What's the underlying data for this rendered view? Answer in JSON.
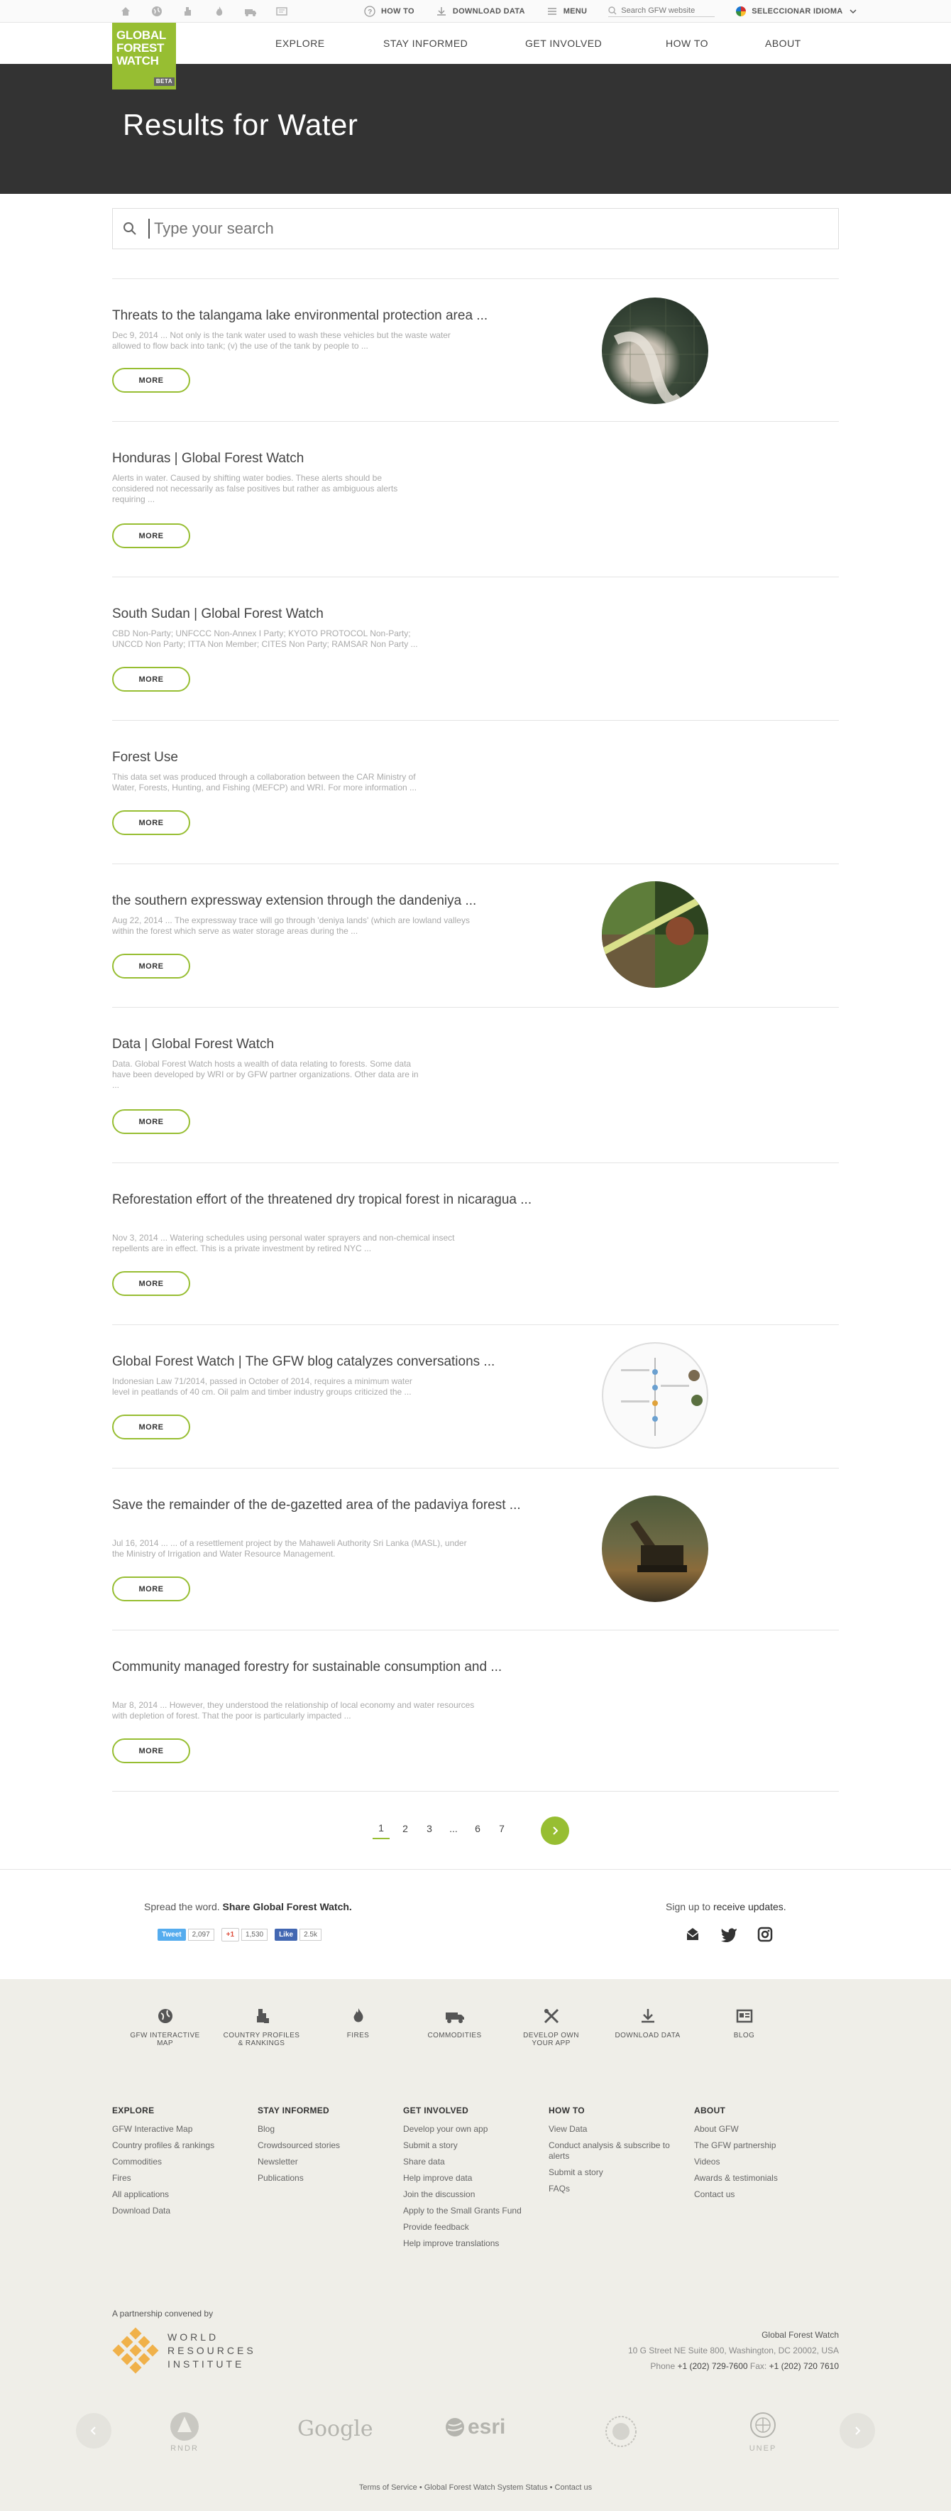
{
  "util": {
    "how_to": "HOW TO",
    "download_data": "DOWNLOAD DATA",
    "menu": "MENU",
    "search_placeholder": "Search GFW website",
    "language": "SELECCIONAR IDIOMA"
  },
  "logo": {
    "line1": "GLOBAL",
    "line2": "FOREST",
    "line3": "WATCH",
    "beta": "BETA"
  },
  "nav": [
    "EXPLORE",
    "STAY INFORMED",
    "GET INVOLVED",
    "HOW TO",
    "ABOUT"
  ],
  "banner": {
    "title": "Results for Water"
  },
  "search": {
    "placeholder": "Type your search"
  },
  "more_label": "MORE",
  "results": [
    {
      "title": "Threats to the talangama lake environmental protection area ...",
      "snippet_1": "Dec 9, 2014 ... Not only is the tank water used to wash these vehicles but the waste water",
      "snippet_2": "allowed to flow back into tank; (v) the use of the tank by people to ...",
      "snippet_3": ""
    },
    {
      "title": "Honduras | Global Forest Watch",
      "snippet_1": "Alerts in water. Caused by shifting water bodies. These alerts should be",
      "snippet_2": "considered not necessarily as false positives but rather as ambiguous alerts",
      "snippet_3": "requiring ..."
    },
    {
      "title": "South Sudan | Global Forest Watch",
      "snippet_1": "CBD Non-Party; UNFCCC Non-Annex I Party; KYOTO PROTOCOL Non-Party;",
      "snippet_2": "UNCCD Non Party; ITTA Non Member; CITES Non Party; RAMSAR Non Party ...",
      "snippet_3": ""
    },
    {
      "title": "Forest Use",
      "snippet_1": "This data set was produced through a collaboration between the CAR Ministry of",
      "snippet_2": "Water, Forests, Hunting, and Fishing (MEFCP) and WRI. For more information ...",
      "snippet_3": ""
    },
    {
      "title": "the southern expressway extension through the dandeniya ...",
      "snippet_1": "Aug 22, 2014 ... The expressway trace will go through 'deniya lands' (which are lowland valleys",
      "snippet_2": "within the forest which serve as water storage areas during the ...",
      "snippet_3": ""
    },
    {
      "title": "Data | Global Forest Watch",
      "snippet_1": "Data. Global Forest Watch hosts a wealth of data relating to forests. Some data",
      "snippet_2": "have been developed by WRI or by GFW partner organizations. Other data are in",
      "snippet_3": "..."
    },
    {
      "title": "Reforestation effort of the threatened dry tropical forest in nicaragua ...",
      "snippet_1": "Nov 3, 2014 ... Watering schedules using personal water sprayers and non-chemical insect",
      "snippet_2": "repellents are in effect. This is a private investment by retired NYC ...",
      "snippet_3": ""
    },
    {
      "title": "Global Forest Watch | The GFW blog catalyzes conversations ...",
      "snippet_1": "Indonesian Law 71/2014, passed in October of 2014, requires a minimum water",
      "snippet_2": "level in peatlands of 40 cm. Oil palm and timber industry groups criticized the ...",
      "snippet_3": ""
    },
    {
      "title": "Save the remainder of the de-gazetted area of the padaviya forest ...",
      "snippet_1": "Jul 16, 2014 ... ... of a resettlement project by the Mahaweli Authority Sri Lanka (MASL), under",
      "snippet_2": "the Ministry of Irrigation and Water Resource Management.",
      "snippet_3": ""
    },
    {
      "title": "Community managed forestry for sustainable consumption and ...",
      "snippet_1": "Mar 8, 2014 ... However, they understood the relationship of local economy and water resources",
      "snippet_2": "with depletion of forest. That the poor is particularly impacted ...",
      "snippet_3": ""
    }
  ],
  "pagination": {
    "pages": [
      "1",
      "2",
      "3",
      "...",
      "6",
      "7"
    ],
    "current": "1"
  },
  "share": {
    "spread": "Spread the word.",
    "share_cta": "Share Global Forest Watch.",
    "signup": "Sign up to",
    "signup_cta": "receive updates.",
    "tweet": "Tweet",
    "tweet_count": "2,097",
    "gplus": "+1",
    "gplus_count": "1,530",
    "fb": "Like",
    "fb_count": "2.5k"
  },
  "apps": [
    {
      "icon": "globe-icon",
      "l1": "GFW INTERACTIVE",
      "l2": "MAP"
    },
    {
      "icon": "country-profiles-icon",
      "l1": "COUNTRY PROFILES",
      "l2": "& RANKINGS"
    },
    {
      "icon": "fires-icon",
      "l1": "FIRES",
      "l2": ""
    },
    {
      "icon": "truck-icon",
      "l1": "COMMODITIES",
      "l2": ""
    },
    {
      "icon": "tools-icon",
      "l1": "DEVELOP OWN",
      "l2": "YOUR APP"
    },
    {
      "icon": "download-icon",
      "l1": "DOWNLOAD DATA",
      "l2": ""
    },
    {
      "icon": "blog-icon",
      "l1": "BLOG",
      "l2": ""
    }
  ],
  "footer_cols": [
    {
      "title": "EXPLORE",
      "items": [
        "GFW Interactive Map",
        "Country profiles & rankings",
        "Commodities",
        "Fires",
        "All applications",
        "Download Data"
      ]
    },
    {
      "title": "STAY INFORMED",
      "items": [
        "Blog",
        "Crowdsourced stories",
        "Newsletter",
        "Publications"
      ]
    },
    {
      "title": "GET INVOLVED",
      "items": [
        "Develop your own app",
        "Submit a story",
        "Share data",
        "Help improve data",
        "Join the discussion",
        "Apply to the Small Grants Fund",
        "Provide feedback",
        "Help improve translations"
      ]
    },
    {
      "title": "HOW TO",
      "items": [
        "View Data",
        "Conduct analysis & subscribe to alerts",
        "Submit a story",
        "FAQs"
      ]
    },
    {
      "title": "ABOUT",
      "items": [
        "About GFW",
        "The GFW partnership",
        "Videos",
        "Awards & testimonials",
        "Contact us"
      ]
    }
  ],
  "partner": {
    "label": "A partnership convened by",
    "wri_1": "WORLD",
    "wri_2": "RESOURCES",
    "wri_3": "INSTITUTE"
  },
  "address": {
    "name": "Global Forest Watch",
    "street": "10 G Street NE Suite 800, Washington, DC 20002, USA",
    "phone_label": "Phone",
    "phone": "+1 (202) 729-7600",
    "fax_label": "Fax:",
    "fax": "+1 (202) 720 7610"
  },
  "partner_logos": {
    "google": "Google",
    "esri": "esri",
    "unep": "UNEP",
    "rnr": "RNDR"
  },
  "legal": {
    "terms": "Terms of Service",
    "sep": " • ",
    "status": "Global Forest Watch System Status",
    "contact": "Contact us"
  },
  "colors": {
    "accent": "#97be32",
    "banner": "#333333",
    "footer_bg": "#efeee8"
  }
}
